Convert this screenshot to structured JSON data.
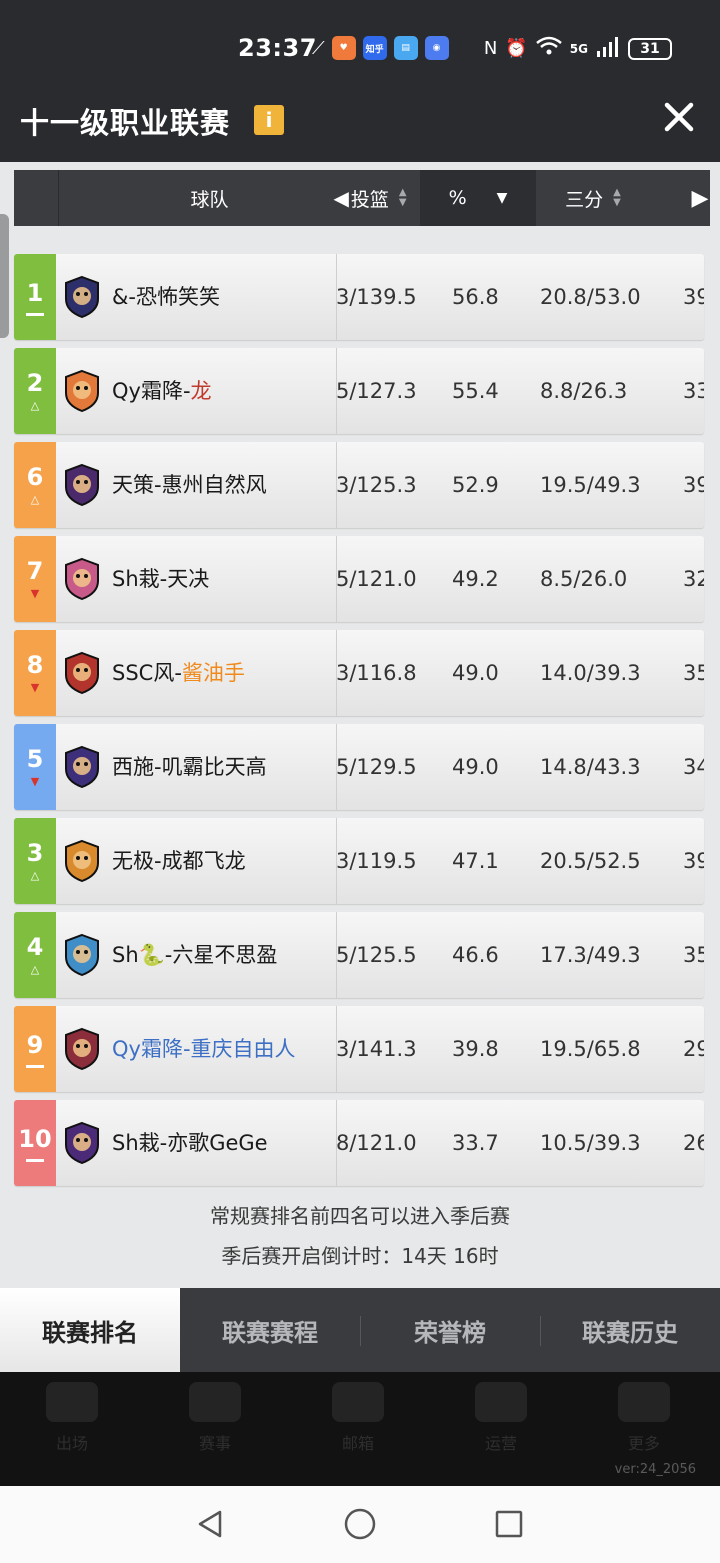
{
  "status_bar": {
    "time": "23:37",
    "apps": [
      {
        "name": "taobao-icon",
        "color": "#f07a3b",
        "text": "♥"
      },
      {
        "name": "zhihu-icon",
        "color": "#2f6bec",
        "text": "知乎"
      },
      {
        "name": "reader-icon",
        "color": "#4aa8f0",
        "text": "▤"
      },
      {
        "name": "browser-icon",
        "color": "#4c7cf0",
        "text": "◉"
      }
    ],
    "network": "5G",
    "battery": "31"
  },
  "header": {
    "title": "十一级职业联赛",
    "info_label": "i",
    "close_label": "✕"
  },
  "table": {
    "columns": {
      "team": "球队",
      "shoot": "投篮",
      "pct": "%",
      "three": "三分"
    },
    "rows": [
      {
        "rank": "1",
        "trend": "none",
        "color": "#7fbe3f",
        "logo_color": "#2d2f6b",
        "team_prefix": "&-恐怖笑笑",
        "team_highlight": "",
        "highlight_color": "",
        "team_color": "#1a1a1a",
        "shoot": "3/139.5",
        "pct": "56.8",
        "three": "20.8/53.0",
        "next": "39"
      },
      {
        "rank": "2",
        "trend": "up",
        "color": "#7fbe3f",
        "logo_color": "#e2783a",
        "team_prefix": "Qy霜降-",
        "team_highlight": "龙",
        "highlight_color": "#c0392b",
        "team_color": "#1a1a1a",
        "shoot": "5/127.3",
        "pct": "55.4",
        "three": "8.8/26.3",
        "next": "33"
      },
      {
        "rank": "6",
        "trend": "up",
        "color": "#f5a24b",
        "logo_color": "#4a2a6a",
        "team_prefix": "天策-惠州自然风",
        "team_highlight": "",
        "highlight_color": "",
        "team_color": "#1a1a1a",
        "shoot": "3/125.3",
        "pct": "52.9",
        "three": "19.5/49.3",
        "next": "39"
      },
      {
        "rank": "7",
        "trend": "down",
        "color": "#f5a24b",
        "logo_color": "#c85a8a",
        "team_prefix": "Sh栽-天决",
        "team_highlight": "",
        "highlight_color": "",
        "team_color": "#1a1a1a",
        "shoot": "5/121.0",
        "pct": "49.2",
        "three": "8.5/26.0",
        "next": "32"
      },
      {
        "rank": "8",
        "trend": "down",
        "color": "#f5a24b",
        "logo_color": "#b2342c",
        "team_prefix": "SSC风-",
        "team_highlight": "酱油手",
        "highlight_color": "#f08a1c",
        "team_color": "#1a1a1a",
        "shoot": "3/116.8",
        "pct": "49.0",
        "three": "14.0/39.3",
        "next": "35"
      },
      {
        "rank": "5",
        "trend": "down",
        "color": "#76aaf0",
        "logo_color": "#3d2f7a",
        "team_prefix": "西施-叽霸比天高",
        "team_highlight": "",
        "highlight_color": "",
        "team_color": "#1a1a1a",
        "shoot": "5/129.5",
        "pct": "49.0",
        "three": "14.8/43.3",
        "next": "34"
      },
      {
        "rank": "3",
        "trend": "up",
        "color": "#7fbe3f",
        "logo_color": "#d98a2c",
        "team_prefix": "无极-成都飞龙",
        "team_highlight": "",
        "highlight_color": "",
        "team_color": "#1a1a1a",
        "shoot": "3/119.5",
        "pct": "47.1",
        "three": "20.5/52.5",
        "next": "39"
      },
      {
        "rank": "4",
        "trend": "up",
        "color": "#7fbe3f",
        "logo_color": "#3f8ec8",
        "team_prefix": "Sh🐍-六星不思盈",
        "team_highlight": "",
        "highlight_color": "",
        "team_color": "#1a1a1a",
        "shoot": "5/125.5",
        "pct": "46.6",
        "three": "17.3/49.3",
        "next": "35"
      },
      {
        "rank": "9",
        "trend": "none",
        "color": "#f5a24b",
        "logo_color": "#8c2d3c",
        "team_prefix": "Qy霜降-重庆自由人",
        "team_highlight": "",
        "highlight_color": "",
        "team_color": "#3d6fc4",
        "shoot": "3/141.3",
        "pct": "39.8",
        "three": "19.5/65.8",
        "next": "29"
      },
      {
        "rank": "10",
        "trend": "none",
        "color": "#ee7b7b",
        "logo_color": "#4b2a78",
        "team_prefix": "Sh栽-亦歌GeGe",
        "team_highlight": "",
        "highlight_color": "",
        "team_color": "#1a1a1a",
        "shoot": "8/121.0",
        "pct": "33.7",
        "three": "10.5/39.3",
        "next": "26"
      }
    ]
  },
  "notes": {
    "line1": "常规赛排名前四名可以进入季后赛",
    "line2": "季后赛开启倒计时：14天 16时"
  },
  "tabs": [
    "联赛排名",
    "联赛赛程",
    "荣誉榜",
    "联赛历史"
  ],
  "dimmed_nav": [
    "出场",
    "赛事",
    "邮箱",
    "运营",
    "更多"
  ],
  "version": "ver:24_2056"
}
